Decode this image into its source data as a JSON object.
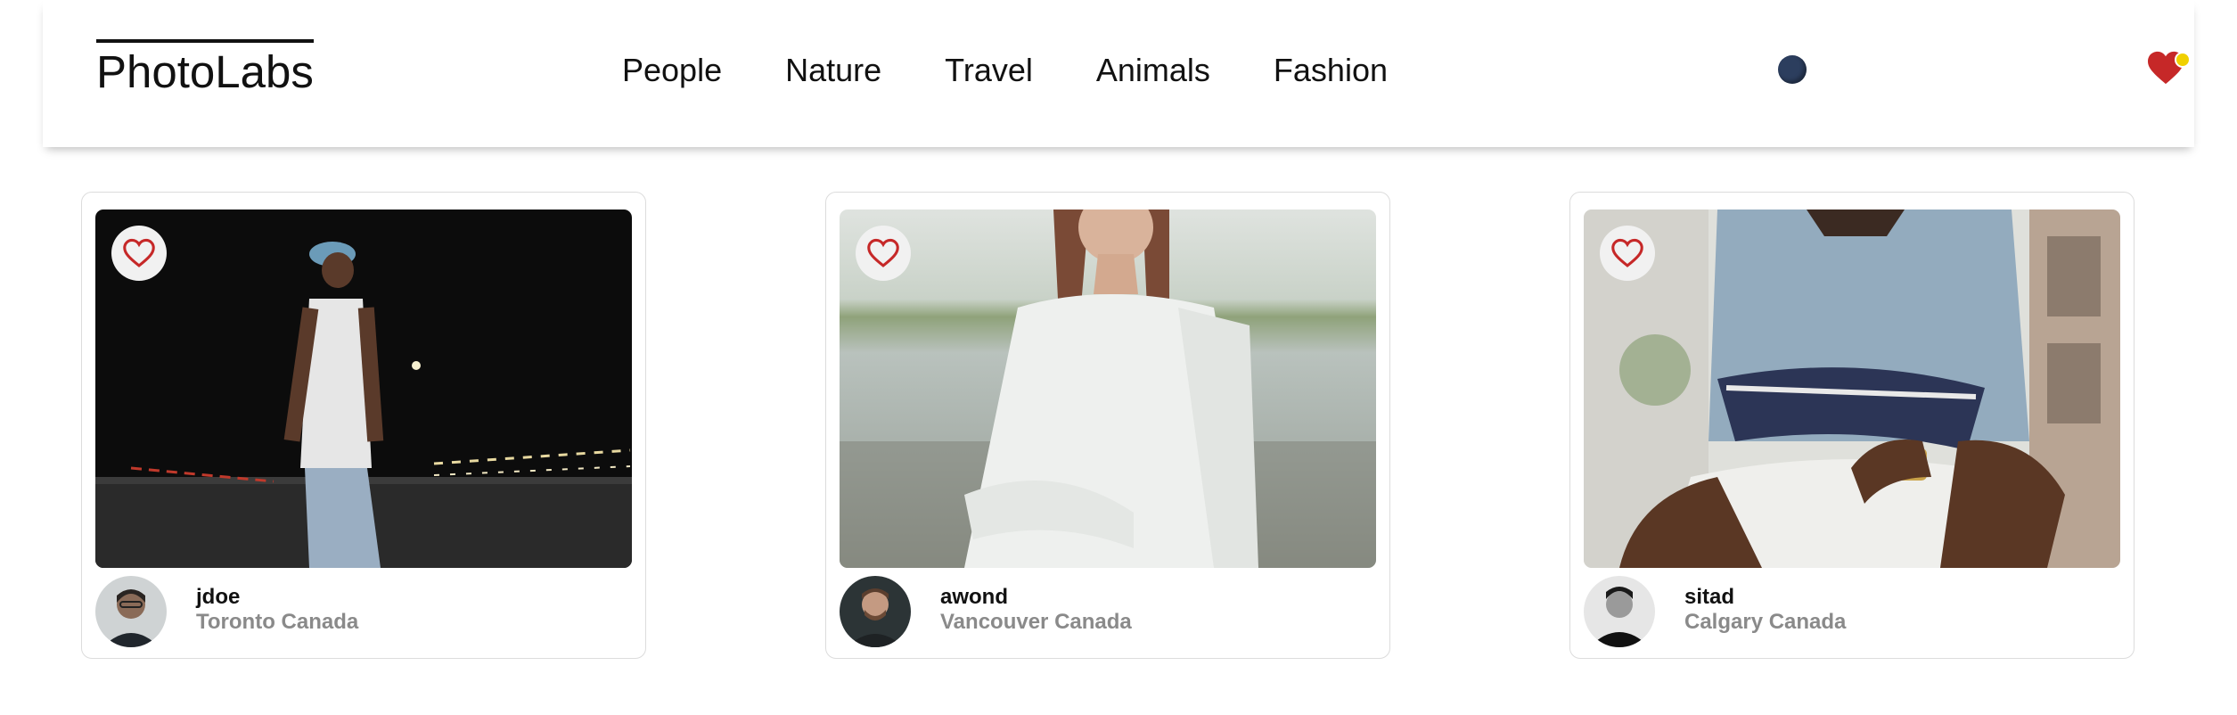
{
  "app": {
    "logo": "PhotoLabs"
  },
  "nav": {
    "topics": [
      "People",
      "Nature",
      "Travel",
      "Animals",
      "Fashion"
    ]
  },
  "header": {
    "favorites_icon": "heart-icon",
    "indicator_color": "#2c3e5e",
    "heart_color": "#c62828",
    "notification_color": "#f0d000"
  },
  "photos": [
    {
      "username": "jdoe",
      "location": "Toronto Canada",
      "like_icon": "heart-outline-icon"
    },
    {
      "username": "awond",
      "location": "Vancouver Canada",
      "like_icon": "heart-outline-icon"
    },
    {
      "username": "sitad",
      "location": "Calgary Canada",
      "like_icon": "heart-outline-icon"
    }
  ]
}
